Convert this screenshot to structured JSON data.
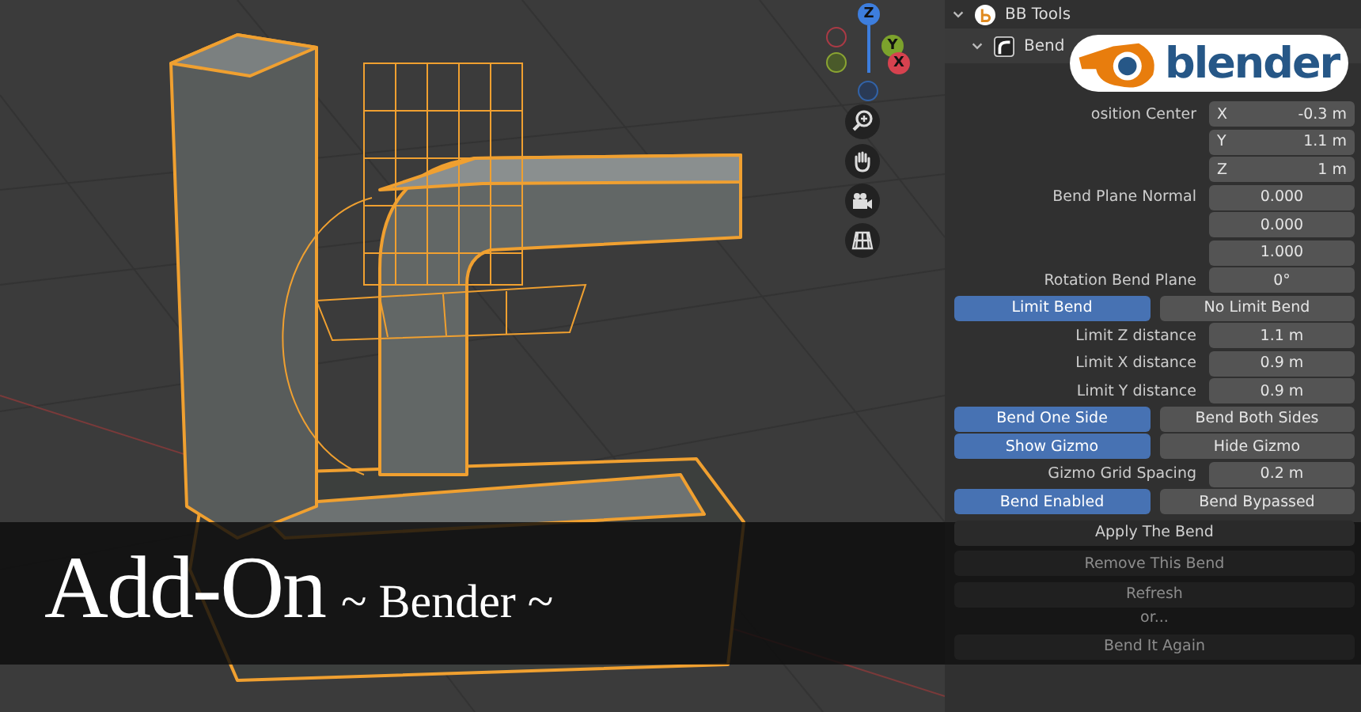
{
  "viewport": {
    "gizmo_axes": [
      {
        "kind": "z",
        "label": "Z"
      },
      {
        "kind": "y",
        "label": "Y"
      },
      {
        "kind": "x",
        "label": "X"
      }
    ]
  },
  "logo": {
    "text": "blender"
  },
  "panel": {
    "title": "BB Tools",
    "subtitle": "Bend",
    "rows": [
      {
        "kind": "field",
        "label": "osition Center",
        "axis": "X",
        "value": "-0.3 m"
      },
      {
        "kind": "field",
        "label": "",
        "axis": "Y",
        "value": "1.1 m"
      },
      {
        "kind": "field",
        "label": "",
        "axis": "Z",
        "value": "1 m"
      },
      {
        "kind": "field",
        "label": "Bend Plane Normal",
        "axis": "",
        "value": "0.000"
      },
      {
        "kind": "field",
        "label": "",
        "axis": "",
        "value": "0.000"
      },
      {
        "kind": "field",
        "label": "",
        "axis": "",
        "value": "1.000"
      },
      {
        "kind": "field",
        "label": "Rotation Bend Plane",
        "axis": "",
        "value": "0°"
      },
      {
        "kind": "toggle",
        "options": [
          {
            "label": "Limit Bend",
            "selected": true
          },
          {
            "label": "No Limit Bend",
            "selected": false
          }
        ]
      },
      {
        "kind": "field",
        "label": "Limit Z distance",
        "axis": "",
        "value": "1.1 m"
      },
      {
        "kind": "field",
        "label": "Limit X distance",
        "axis": "",
        "value": "0.9 m"
      },
      {
        "kind": "field",
        "label": "Limit Y distance",
        "axis": "",
        "value": "0.9 m"
      },
      {
        "kind": "toggle",
        "options": [
          {
            "label": "Bend One Side",
            "selected": true
          },
          {
            "label": "Bend Both Sides",
            "selected": false
          }
        ]
      },
      {
        "kind": "toggle",
        "options": [
          {
            "label": "Show Gizmo",
            "selected": true
          },
          {
            "label": "Hide Gizmo",
            "selected": false
          }
        ]
      },
      {
        "kind": "field",
        "label": "Gizmo Grid Spacing",
        "axis": "",
        "value": "0.2 m"
      },
      {
        "kind": "toggle",
        "options": [
          {
            "label": "Bend Enabled",
            "selected": true
          },
          {
            "label": "Bend Bypassed",
            "selected": false
          }
        ]
      },
      {
        "kind": "button",
        "label": "Apply The Bend",
        "disabled": false
      },
      {
        "kind": "button",
        "label": "Remove This Bend",
        "disabled": true
      },
      {
        "kind": "button",
        "label": "Refresh",
        "disabled": true
      },
      {
        "kind": "note",
        "label": "or..."
      },
      {
        "kind": "button",
        "label": "Bend It Again",
        "disabled": true
      }
    ]
  },
  "banner": {
    "title": "Add-On",
    "subtitle": "~ Bender ~"
  }
}
